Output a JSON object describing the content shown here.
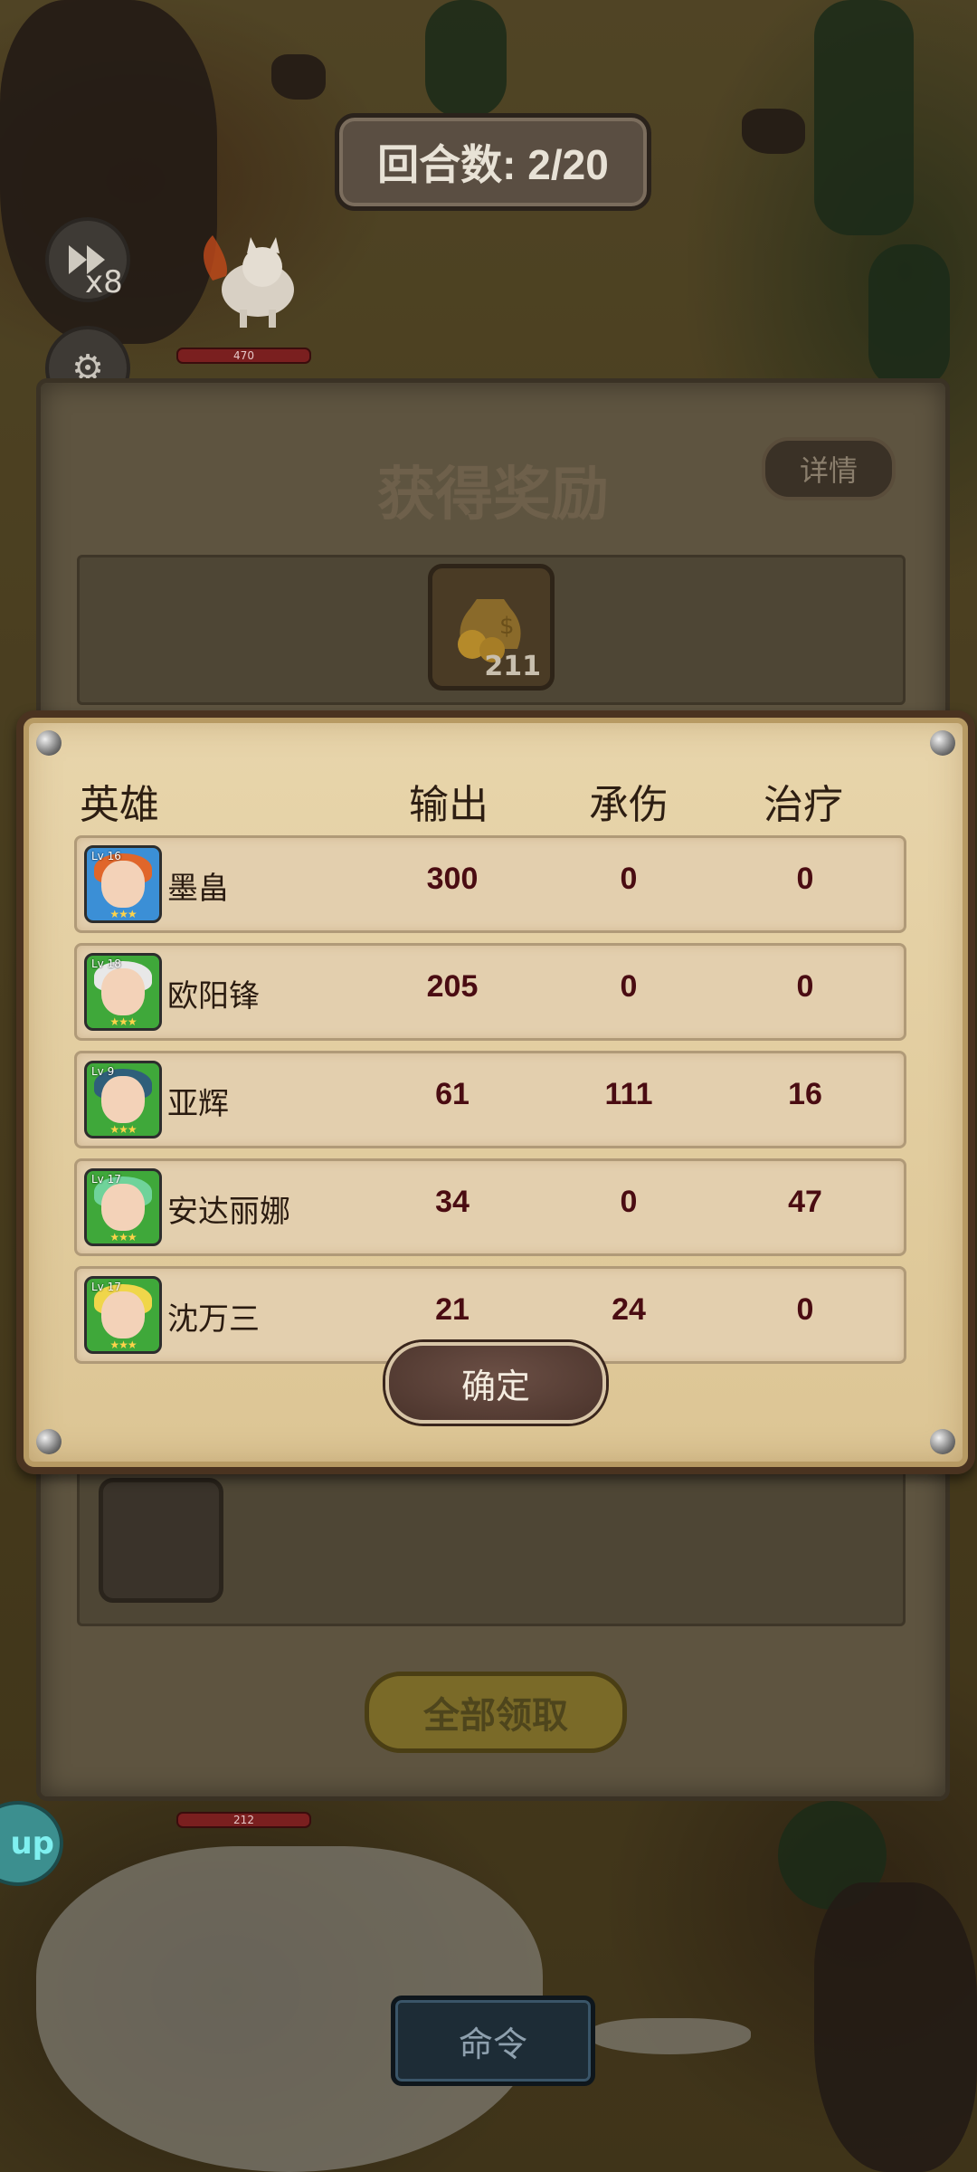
{
  "hud": {
    "round_label": "回合数: 2/20",
    "speed_label": "x8",
    "enemy_hp_top": "470",
    "enemy_hp_bottom": "212",
    "command_label": "命令",
    "edge_badge_text": "up"
  },
  "rewards": {
    "title": "获得奖励",
    "detail_label": "详情",
    "coin_count": "211",
    "claim_all_label": "全部领取"
  },
  "stats": {
    "headers": {
      "hero": "英雄",
      "output": "输出",
      "damage_taken": "承伤",
      "healing": "治疗"
    },
    "rows": [
      {
        "name": "墨畠",
        "output": "300",
        "damage_taken": "0",
        "healing": "0",
        "level": "Lv 16",
        "frame_color": "#3b8fd6",
        "hair_color": "#e0662a"
      },
      {
        "name": "欧阳锋",
        "output": "205",
        "damage_taken": "0",
        "healing": "0",
        "level": "Lv 18",
        "frame_color": "#3fa83a",
        "hair_color": "#e8e8e8"
      },
      {
        "name": "亚辉",
        "output": "61",
        "damage_taken": "111",
        "healing": "16",
        "level": "Lv 9",
        "frame_color": "#3fa83a",
        "hair_color": "#2f5f7a"
      },
      {
        "name": "安达丽娜",
        "output": "34",
        "damage_taken": "0",
        "healing": "47",
        "level": "Lv 17",
        "frame_color": "#3fa83a",
        "hair_color": "#6fd39a"
      },
      {
        "name": "沈万三",
        "output": "21",
        "damage_taken": "24",
        "healing": "0",
        "level": "Lv 17",
        "frame_color": "#3fa83a",
        "hair_color": "#f0d64a"
      }
    ],
    "confirm_label": "确定"
  },
  "colors": {
    "stat_value": "#4a0c12",
    "panel_border": "#4a3320",
    "panel_fill": "#e8d5ab"
  }
}
